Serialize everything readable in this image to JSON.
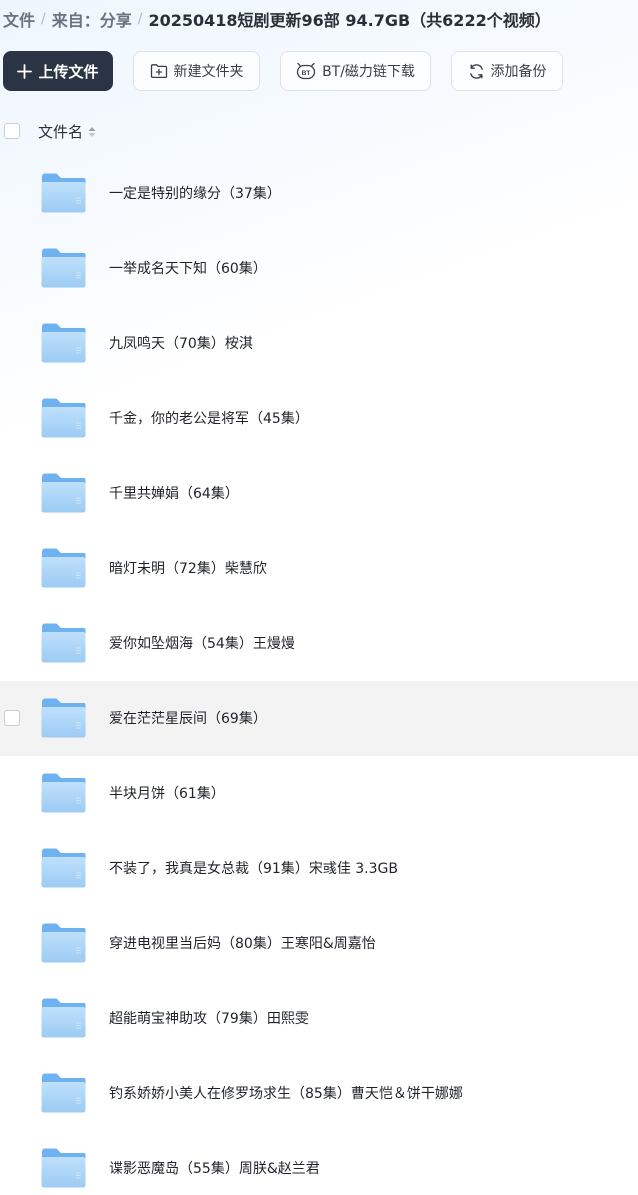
{
  "breadcrumb": {
    "root": "文件",
    "shared_from": "来自：分享",
    "current": "20250418短剧更新96部 94.7GB（共6222个视频）"
  },
  "toolbar": {
    "upload_label": "上传文件",
    "new_folder_label": "新建文件夹",
    "bt_label": "BT/磁力链下载",
    "backup_label": "添加备份",
    "upload_icon": "plus-icon",
    "new_folder_icon": "folder-plus-icon",
    "bt_icon": "bt-icon",
    "backup_icon": "sync-icon"
  },
  "list_header": {
    "name_label": "文件名"
  },
  "files": [
    {
      "name": "一定是特别的缘分（37集）"
    },
    {
      "name": "一举成名天下知（60集）"
    },
    {
      "name": "九凤鸣天（70集）桉淇"
    },
    {
      "name": "千金，你的老公是将军（45集）"
    },
    {
      "name": "千里共婵娟（64集）"
    },
    {
      "name": "暗灯未明（72集）柴慧欣"
    },
    {
      "name": "爱你如坠烟海（54集）王熳熳"
    },
    {
      "name": "爱在茫茫星辰间（69集）",
      "hovered": true
    },
    {
      "name": "半块月饼（61集）"
    },
    {
      "name": "不装了，我真是女总裁（91集）宋彧佳 3.3GB"
    },
    {
      "name": "穿进电视里当后妈（80集）王寒阳&周嘉怡"
    },
    {
      "name": "超能萌宝神助攻（79集）田熙雯"
    },
    {
      "name": "钓系娇娇小美人在修罗场求生（85集）曹天恺＆饼干娜娜"
    },
    {
      "name": "谍影恶魔岛（55集）周朕&赵兰君"
    }
  ],
  "colors": {
    "primary_button": "#2b3444",
    "folder_light": "#a9d2f7",
    "folder_dark": "#6eb3ef",
    "hover_row": "#f3f3f4"
  }
}
